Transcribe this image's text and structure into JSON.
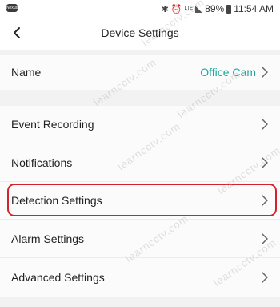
{
  "status_bar": {
    "carrier_badge": "Nexus",
    "battery": "89%",
    "time": "11:54 AM",
    "network": "LTE"
  },
  "header": {
    "title": "Device Settings",
    "back_icon": "chevron-left-icon"
  },
  "settings": {
    "name": {
      "label": "Name",
      "value": "Office Cam"
    },
    "items": [
      {
        "label": "Event Recording"
      },
      {
        "label": "Notifications"
      },
      {
        "label": "Detection Settings",
        "highlighted": true
      },
      {
        "label": "Alarm Settings"
      },
      {
        "label": "Advanced Settings"
      }
    ]
  },
  "watermark": "learncctv.com",
  "colors": {
    "accent": "#1fa89c",
    "highlight": "#d4222a",
    "section_gap": "#f2f2f2"
  }
}
